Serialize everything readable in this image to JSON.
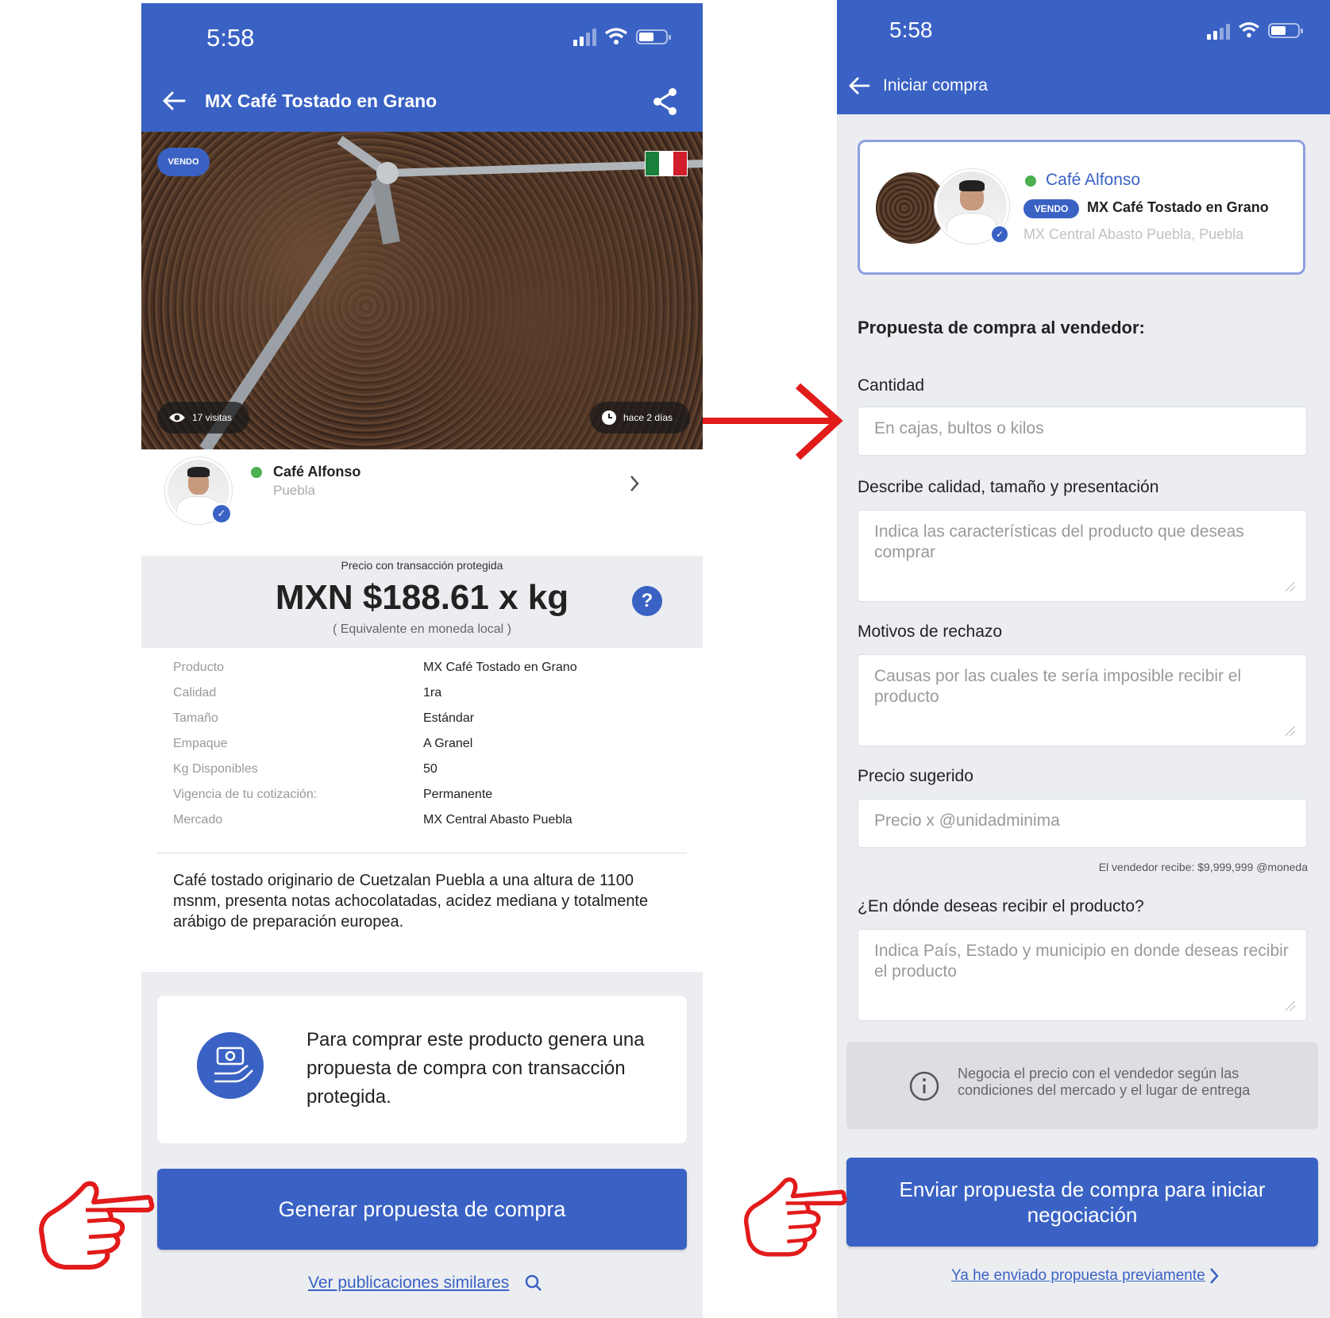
{
  "left": {
    "status": {
      "time": "5:58"
    },
    "header": {
      "title": "MX Café Tostado en Grano"
    },
    "hero": {
      "badge": "VENDO",
      "views": "17 visitas",
      "posted": "hace 2 días"
    },
    "seller": {
      "name": "Café Alfonso",
      "location": "Puebla"
    },
    "price": {
      "caption": "Precio con transacción protegida",
      "value": "MXN $188.61 x kg",
      "note": "( Equivalente en moneda local )",
      "help": "?"
    },
    "details": [
      {
        "k": "Producto",
        "v": "MX Café Tostado en Grano"
      },
      {
        "k": "Calidad",
        "v": "1ra"
      },
      {
        "k": "Tamaño",
        "v": "Estándar"
      },
      {
        "k": "Empaque",
        "v": "A Granel"
      },
      {
        "k": "Kg Disponibles",
        "v": "50"
      },
      {
        "k": "Vigencia de tu cotización:",
        "v": "Permanente"
      },
      {
        "k": "Mercado",
        "v": "MX Central Abasto Puebla"
      }
    ],
    "description": "Café tostado originario de Cuetzalan Puebla a una altura de 1100 msnm, presenta notas achocolatadas, acidez mediana y totalmente arábigo de preparación europea.",
    "info": "Para comprar este producto genera una propuesta de compra con transacción protegida.",
    "cta": "Generar propuesta de compra",
    "similar_link": "Ver publicaciones similares"
  },
  "right": {
    "status": {
      "time": "5:58"
    },
    "header": {
      "title": "Iniciar compra"
    },
    "card": {
      "seller": "Café Alfonso",
      "badge": "VENDO",
      "product": "MX Café Tostado en Grano",
      "market": "MX Central Abasto Puebla, Puebla"
    },
    "section_title": "Propuesta de compra al vendedor:",
    "fields": {
      "cantidad": {
        "label": "Cantidad",
        "placeholder": "En cajas, bultos o kilos"
      },
      "calidad": {
        "label": "Describe calidad, tamaño y presentación",
        "placeholder": "Indica las características del producto que deseas comprar"
      },
      "rechazo": {
        "label": "Motivos de rechazo",
        "placeholder": "Causas por las cuales te sería imposible recibir el producto"
      },
      "precio": {
        "label": "Precio sugerido",
        "placeholder": "Precio x @unidadminima",
        "hint": "El vendedor recibe: $9,999,999 @moneda"
      },
      "entrega": {
        "label": "¿En dónde deseas recibir el producto?",
        "placeholder": "Indica País, Estado y municipio en donde deseas recibir el producto"
      }
    },
    "note": "Negocia el precio con el vendedor según las condiciones del mercado y el lugar de entrega",
    "cta": "Enviar propuesta de compra para iniciar negociación",
    "prev_link": "Ya he enviado propuesta previamente"
  },
  "colors": {
    "brand": "#3a62c4",
    "annotation": "#e21b1b",
    "online": "#4caf50"
  },
  "icons": [
    "back-arrow-icon",
    "share-icon",
    "eye-icon",
    "clock-icon",
    "chevron-right-icon",
    "help-icon",
    "money-hand-icon",
    "search-icon",
    "info-icon",
    "pointing-hand-icon",
    "red-arrow-icon"
  ]
}
